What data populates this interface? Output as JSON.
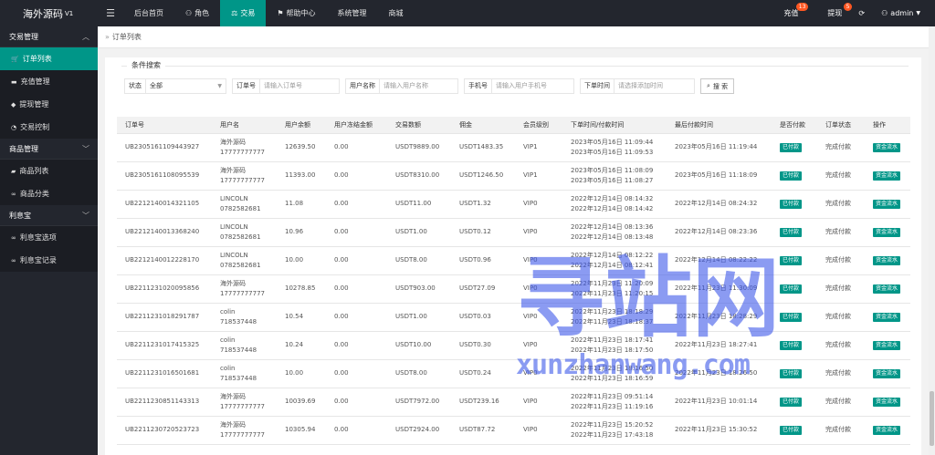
{
  "app": {
    "logo": "海外源码",
    "version": "V1"
  },
  "topnav": {
    "items": [
      {
        "icon": "",
        "label": "后台首页"
      },
      {
        "icon": "user-icon",
        "label": "角色"
      },
      {
        "icon": "scale-icon",
        "label": "交易"
      },
      {
        "icon": "flag-icon",
        "label": "帮助中心"
      },
      {
        "icon": "",
        "label": "系统管理"
      },
      {
        "icon": "",
        "label": "商城"
      }
    ],
    "recharge": {
      "label": "充值",
      "badge": "13"
    },
    "withdraw": {
      "label": "提现",
      "badge": "5"
    },
    "user": "admin"
  },
  "sidebar": {
    "groups": [
      {
        "label": "交易管理",
        "items": [
          "订单列表",
          "充值管理",
          "提现管理",
          "交易控制"
        ]
      },
      {
        "label": "商品管理",
        "items": [
          "商品列表",
          "商品分类"
        ]
      },
      {
        "label": "利息宝",
        "items": [
          "利息宝选项",
          "利息宝记录"
        ]
      }
    ]
  },
  "breadcrumb": "订单列表",
  "search": {
    "legend": "条件搜索",
    "status_label": "状态",
    "status_value": "全部",
    "order_label": "订单号",
    "order_placeholder": "请输入订单号",
    "username_label": "用户名称",
    "username_placeholder": "请输入用户名称",
    "phone_label": "手机号",
    "phone_placeholder": "请输入用户手机号",
    "time_label": "下单时间",
    "time_placeholder": "请选择添加时间",
    "button": "搜 索"
  },
  "table": {
    "headers": [
      "订单号",
      "用户名",
      "用户余额",
      "用户冻结金额",
      "交易数额",
      "佣金",
      "会员级别",
      "下单时间/付款时间",
      "最后付款时间",
      "是否付款",
      "订单状态",
      "操作"
    ],
    "rows": [
      {
        "id": "UB2305161109443927",
        "user": "海外源码",
        "phone": "17777777777",
        "balance": "12639.50",
        "frozen": "0.00",
        "amount": "USDT9889.00",
        "commission": "USDT1483.35",
        "level": "VIP1",
        "t1": "2023年05月16日 11:09:44",
        "t2": "2023年05月16日 11:09:53",
        "last": "2023年05月16日 11:19:44",
        "paid": "已付款",
        "status": "完成付款",
        "action": "资金流水"
      },
      {
        "id": "UB2305161108095539",
        "user": "海外源码",
        "phone": "17777777777",
        "balance": "11393.00",
        "frozen": "0.00",
        "amount": "USDT8310.00",
        "commission": "USDT1246.50",
        "level": "VIP1",
        "t1": "2023年05月16日 11:08:09",
        "t2": "2023年05月16日 11:08:27",
        "last": "2023年05月16日 11:18:09",
        "paid": "已付款",
        "status": "完成付款",
        "action": "资金流水"
      },
      {
        "id": "UB2212140014321105",
        "user": "LINCOLN",
        "phone": "0782582681",
        "balance": "11.08",
        "frozen": "0.00",
        "amount": "USDT11.00",
        "commission": "USDT1.32",
        "level": "VIP0",
        "t1": "2022年12月14日 08:14:32",
        "t2": "2022年12月14日 08:14:42",
        "last": "2022年12月14日 08:24:32",
        "paid": "已付款",
        "status": "完成付款",
        "action": "资金流水"
      },
      {
        "id": "UB2212140013368240",
        "user": "LINCOLN",
        "phone": "0782582681",
        "balance": "10.96",
        "frozen": "0.00",
        "amount": "USDT1.00",
        "commission": "USDT0.12",
        "level": "VIP0",
        "t1": "2022年12月14日 08:13:36",
        "t2": "2022年12月14日 08:13:48",
        "last": "2022年12月14日 08:23:36",
        "paid": "已付款",
        "status": "完成付款",
        "action": "资金流水"
      },
      {
        "id": "UB2212140012228170",
        "user": "LINCOLN",
        "phone": "0782582681",
        "balance": "10.00",
        "frozen": "0.00",
        "amount": "USDT8.00",
        "commission": "USDT0.96",
        "level": "VIP0",
        "t1": "2022年12月14日 08:12:22",
        "t2": "2022年12月14日 08:12:41",
        "last": "2022年12月14日 08:22:22",
        "paid": "已付款",
        "status": "完成付款",
        "action": "资金流水"
      },
      {
        "id": "UB2211231020095856",
        "user": "海外源码",
        "phone": "17777777777",
        "balance": "10278.85",
        "frozen": "0.00",
        "amount": "USDT903.00",
        "commission": "USDT27.09",
        "level": "VIP0",
        "t1": "2022年11月23日 11:20:09",
        "t2": "2022年11月23日 11:20:15",
        "last": "2022年11月23日 11:30:09",
        "paid": "已付款",
        "status": "完成付款",
        "action": "资金流水"
      },
      {
        "id": "UB2211231018291787",
        "user": "colin",
        "phone": "718537448",
        "balance": "10.54",
        "frozen": "0.00",
        "amount": "USDT1.00",
        "commission": "USDT0.03",
        "level": "VIP0",
        "t1": "2022年11月23日 18:18:29",
        "t2": "2022年11月23日 18:18:37",
        "last": "2022年11月23日 18:28:29",
        "paid": "已付款",
        "status": "完成付款",
        "action": "资金流水"
      },
      {
        "id": "UB2211231017415325",
        "user": "colin",
        "phone": "718537448",
        "balance": "10.24",
        "frozen": "0.00",
        "amount": "USDT10.00",
        "commission": "USDT0.30",
        "level": "VIP0",
        "t1": "2022年11月23日 18:17:41",
        "t2": "2022年11月23日 18:17:50",
        "last": "2022年11月23日 18:27:41",
        "paid": "已付款",
        "status": "完成付款",
        "action": "资金流水"
      },
      {
        "id": "UB2211231016501681",
        "user": "colin",
        "phone": "718537448",
        "balance": "10.00",
        "frozen": "0.00",
        "amount": "USDT8.00",
        "commission": "USDT0.24",
        "level": "VIP0",
        "t1": "2022年11月23日 18:16:50",
        "t2": "2022年11月23日 18:16:59",
        "last": "2022年11月23日 18:26:50",
        "paid": "已付款",
        "status": "完成付款",
        "action": "资金流水"
      },
      {
        "id": "UB2211230851143313",
        "user": "海外源码",
        "phone": "17777777777",
        "balance": "10039.69",
        "frozen": "0.00",
        "amount": "USDT7972.00",
        "commission": "USDT239.16",
        "level": "VIP0",
        "t1": "2022年11月23日 09:51:14",
        "t2": "2022年11月23日 11:19:16",
        "last": "2022年11月23日 10:01:14",
        "paid": "已付款",
        "status": "完成付款",
        "action": "资金流水"
      },
      {
        "id": "UB2211230720523723",
        "user": "海外源码",
        "phone": "17777777777",
        "balance": "10305.94",
        "frozen": "0.00",
        "amount": "USDT2924.00",
        "commission": "USDT87.72",
        "level": "VIP0",
        "t1": "2022年11月23日 15:20:52",
        "t2": "2022年11月23日 17:43:18",
        "last": "2022年11月23日 15:30:52",
        "paid": "已付款",
        "status": "完成付款",
        "action": "资金流水"
      }
    ]
  },
  "watermark": {
    "main": "寻站网",
    "sub": "xunzhanwang.com",
    "color": "#3d59ea"
  },
  "colors": {
    "accent": "#009688",
    "dark": "#23262e",
    "badge": "#ff5722"
  }
}
